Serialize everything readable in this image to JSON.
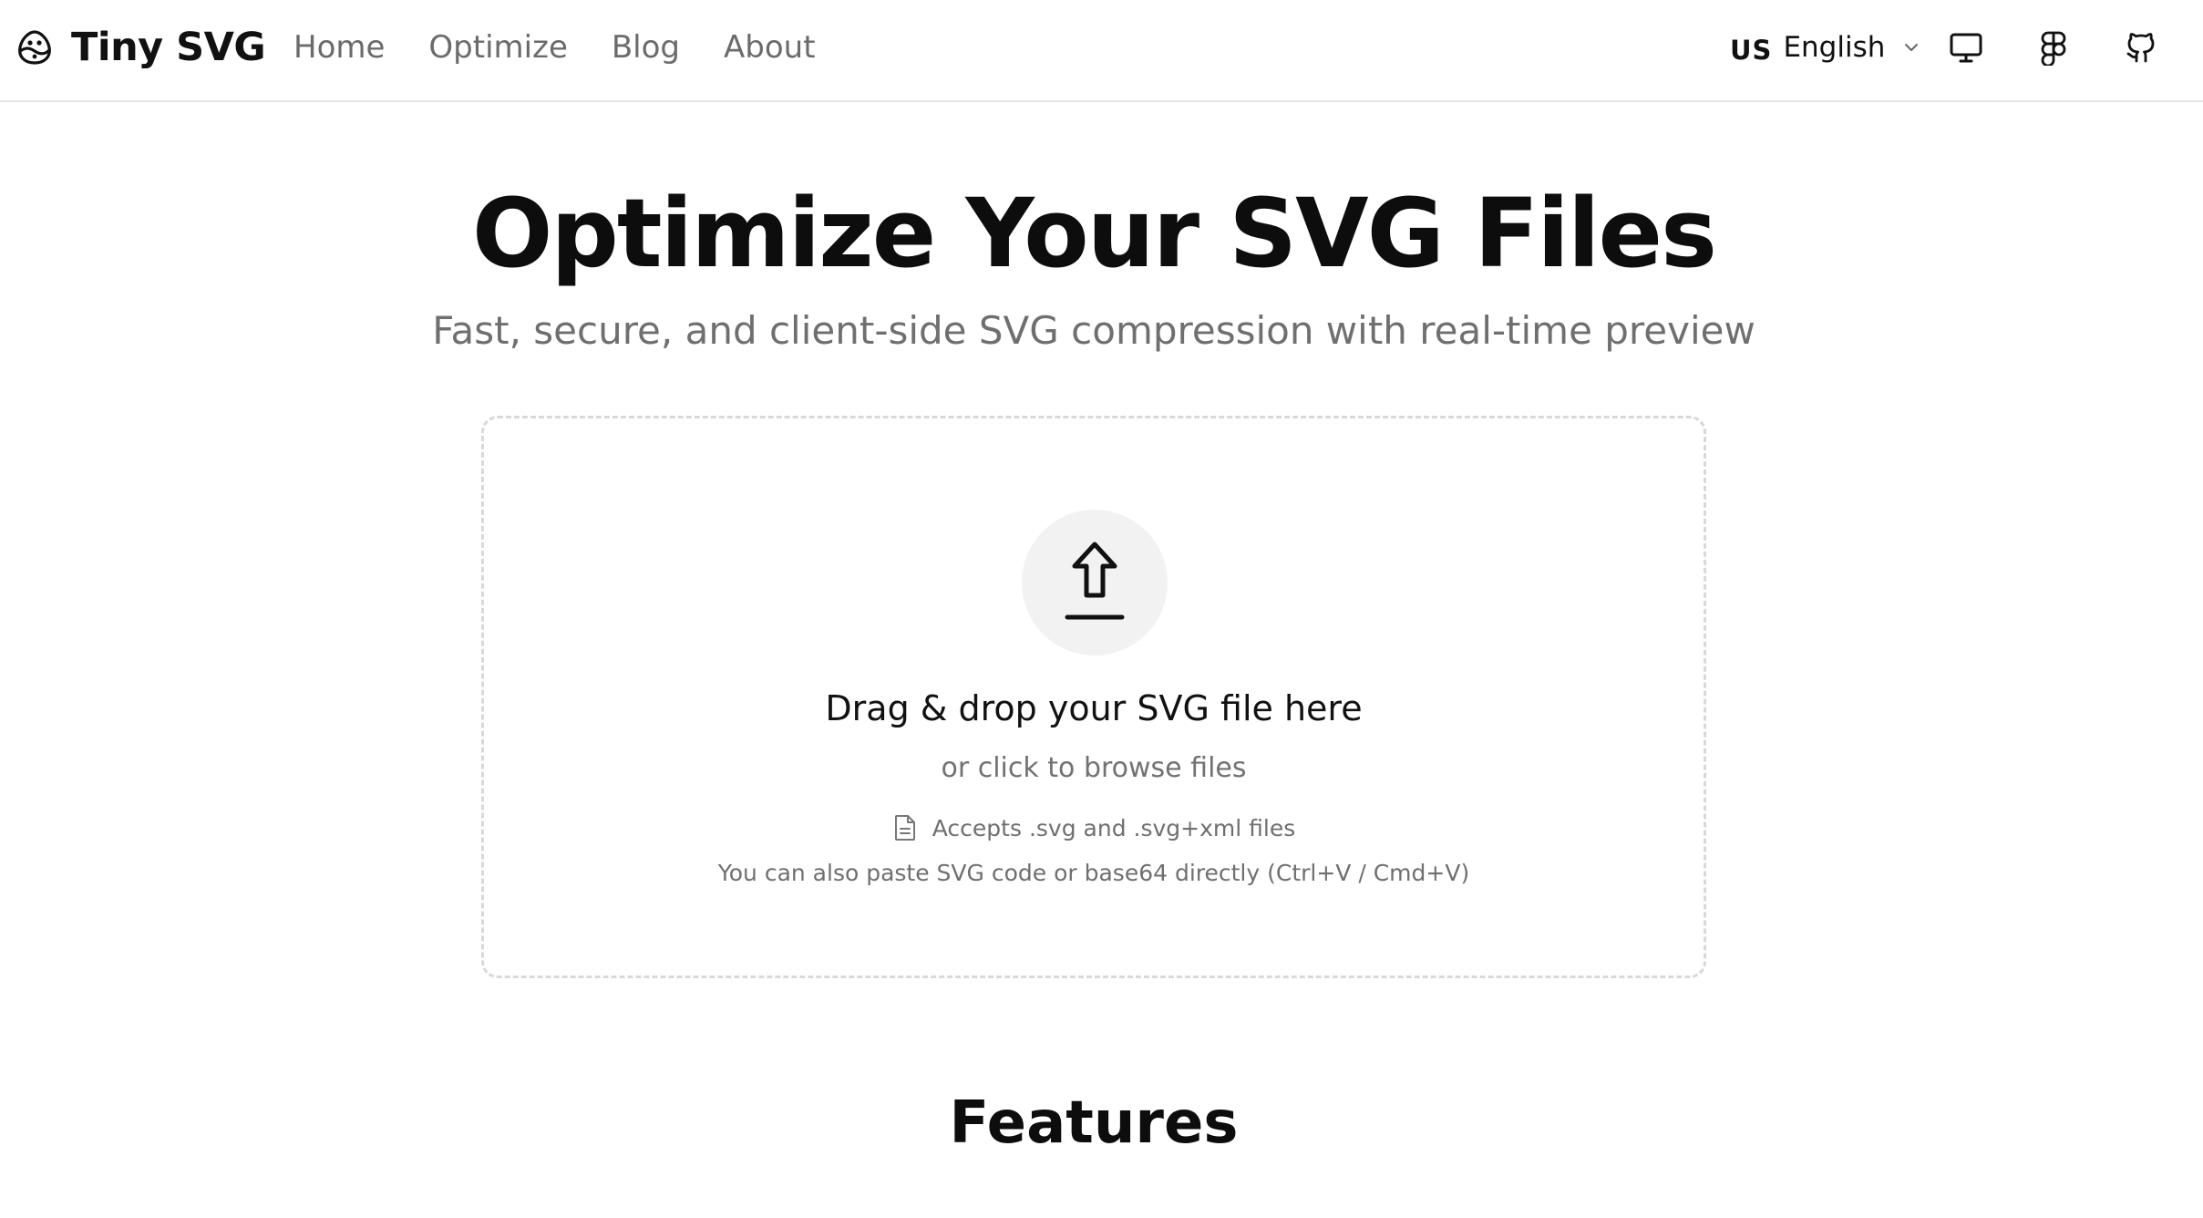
{
  "header": {
    "brand": "Tiny SVG",
    "nav": [
      "Home",
      "Optimize",
      "Blog",
      "About"
    ],
    "language": {
      "flag": "US",
      "label": "English"
    },
    "icons": [
      "monitor-icon",
      "figma-icon",
      "github-icon"
    ]
  },
  "hero": {
    "title": "Optimize Your SVG Files",
    "subtitle": "Fast, secure, and client-side SVG compression with real-time preview"
  },
  "dropzone": {
    "title": "Drag & drop your SVG file here",
    "subtitle": "or click to browse files",
    "accepts": "Accepts .svg and .svg+xml files",
    "paste_hint": "You can also paste SVG code or base64 directly (Ctrl+V / Cmd+V)",
    "icon": "upload-arrow-icon"
  },
  "features": {
    "title": "Features"
  },
  "colors": {
    "text": "#111111",
    "muted": "#6f6f6f",
    "border": "#d9d9d9",
    "circle": "#f2f2f2"
  }
}
